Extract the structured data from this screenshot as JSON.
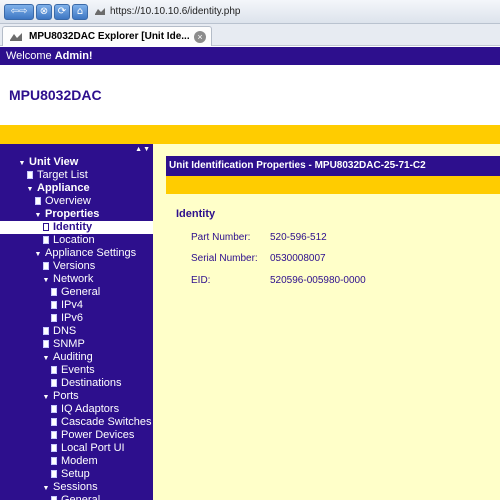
{
  "browser": {
    "url": "https://10.10.10.6/identity.php",
    "tab_title": "MPU8032DAC Explorer [Unit Ide..."
  },
  "welcome": {
    "prefix": "Welcome ",
    "user": "Admin!"
  },
  "header": {
    "title": "MPU8032DAC"
  },
  "sidebar": {
    "items": [
      {
        "label": "Unit View",
        "depth": 0,
        "icon": "expanded",
        "bold": true
      },
      {
        "label": "Target List",
        "depth": 1,
        "icon": "doc"
      },
      {
        "label": "Appliance",
        "depth": 1,
        "icon": "expanded",
        "bold": true
      },
      {
        "label": "Overview",
        "depth": 2,
        "icon": "doc"
      },
      {
        "label": "Properties",
        "depth": 2,
        "icon": "expanded",
        "bold": true
      },
      {
        "label": "Identity",
        "depth": 3,
        "icon": "doc",
        "selected": true,
        "bold": true
      },
      {
        "label": "Location",
        "depth": 3,
        "icon": "doc"
      },
      {
        "label": "Appliance Settings",
        "depth": 2,
        "icon": "expanded"
      },
      {
        "label": "Versions",
        "depth": 3,
        "icon": "doc"
      },
      {
        "label": "Network",
        "depth": 3,
        "icon": "expanded"
      },
      {
        "label": "General",
        "depth": 4,
        "icon": "doc"
      },
      {
        "label": "IPv4",
        "depth": 4,
        "icon": "doc"
      },
      {
        "label": "IPv6",
        "depth": 4,
        "icon": "doc"
      },
      {
        "label": "DNS",
        "depth": 3,
        "icon": "doc"
      },
      {
        "label": "SNMP",
        "depth": 3,
        "icon": "doc"
      },
      {
        "label": "Auditing",
        "depth": 3,
        "icon": "expanded"
      },
      {
        "label": "Events",
        "depth": 4,
        "icon": "doc"
      },
      {
        "label": "Destinations",
        "depth": 4,
        "icon": "doc"
      },
      {
        "label": "Ports",
        "depth": 3,
        "icon": "expanded"
      },
      {
        "label": "IQ Adaptors",
        "depth": 4,
        "icon": "doc"
      },
      {
        "label": "Cascade Switches",
        "depth": 4,
        "icon": "doc"
      },
      {
        "label": "Power Devices",
        "depth": 4,
        "icon": "doc"
      },
      {
        "label": "Local Port UI",
        "depth": 4,
        "icon": "doc"
      },
      {
        "label": "Modem",
        "depth": 4,
        "icon": "doc"
      },
      {
        "label": "Setup",
        "depth": 4,
        "icon": "doc"
      },
      {
        "label": "Sessions",
        "depth": 3,
        "icon": "expanded"
      },
      {
        "label": "General",
        "depth": 4,
        "icon": "doc"
      }
    ]
  },
  "main": {
    "panel_title": "Unit Identification Properties - MPU8032DAC-25-71-C2",
    "section_title": "Identity",
    "properties": [
      {
        "label": "Part Number:",
        "value": "520-596-512"
      },
      {
        "label": "Serial Number:",
        "value": "0530008007"
      },
      {
        "label": "EID:",
        "value": "520596-005980-0000"
      }
    ]
  },
  "colors": {
    "brand": "#2d0f8d",
    "accent": "#ffcc00",
    "panel_bg": "#ffffc9"
  }
}
